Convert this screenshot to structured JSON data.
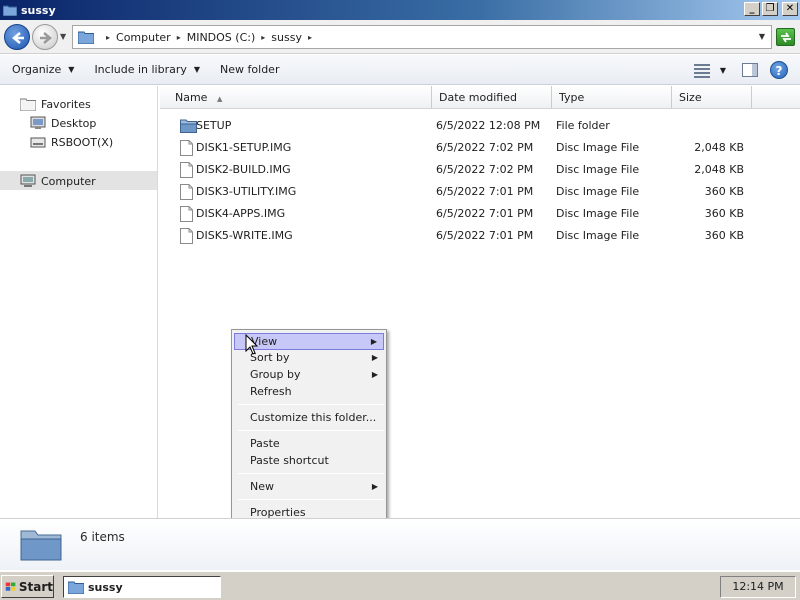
{
  "window": {
    "title": "sussy"
  },
  "address": {
    "crumbs": [
      "Computer",
      "MINDOS (C:)",
      "sussy"
    ]
  },
  "toolbar": {
    "organize_label": "Organize",
    "include_label": "Include in library",
    "newfolder_label": "New folder"
  },
  "nav": {
    "favorites_label": "Favorites",
    "desktop_label": "Desktop",
    "rsboot_label": "RSBOOT(X)",
    "computer_label": "Computer"
  },
  "columns": {
    "name": "Name",
    "date": "Date modified",
    "type": "Type",
    "size": "Size"
  },
  "files": [
    {
      "name": "SETUP",
      "date": "6/5/2022 12:08 PM",
      "type": "File folder",
      "size": "",
      "icon": "folder-icon"
    },
    {
      "name": "DISK1-SETUP.IMG",
      "date": "6/5/2022 7:02 PM",
      "type": "Disc Image File",
      "size": "2,048 KB",
      "icon": "file-icon"
    },
    {
      "name": "DISK2-BUILD.IMG",
      "date": "6/5/2022 7:02 PM",
      "type": "Disc Image File",
      "size": "2,048 KB",
      "icon": "file-icon"
    },
    {
      "name": "DISK3-UTILITY.IMG",
      "date": "6/5/2022 7:01 PM",
      "type": "Disc Image File",
      "size": "360 KB",
      "icon": "file-icon"
    },
    {
      "name": "DISK4-APPS.IMG",
      "date": "6/5/2022 7:01 PM",
      "type": "Disc Image File",
      "size": "360 KB",
      "icon": "file-icon"
    },
    {
      "name": "DISK5-WRITE.IMG",
      "date": "6/5/2022 7:01 PM",
      "type": "Disc Image File",
      "size": "360 KB",
      "icon": "file-icon"
    }
  ],
  "context_menu": {
    "view": "View",
    "sort_by": "Sort by",
    "group_by": "Group by",
    "refresh": "Refresh",
    "customize": "Customize this folder...",
    "paste": "Paste",
    "paste_shortcut": "Paste shortcut",
    "new": "New",
    "properties": "Properties"
  },
  "details": {
    "count": "6 items"
  },
  "taskbar": {
    "start_label": "Start",
    "task_label": "sussy",
    "clock": "12:14 PM"
  },
  "colors": {
    "titlebar_start": "#0a246a",
    "titlebar_end": "#a6caf0",
    "menu_highlight": "#c8c8f8",
    "folder": "#4f86c6"
  }
}
